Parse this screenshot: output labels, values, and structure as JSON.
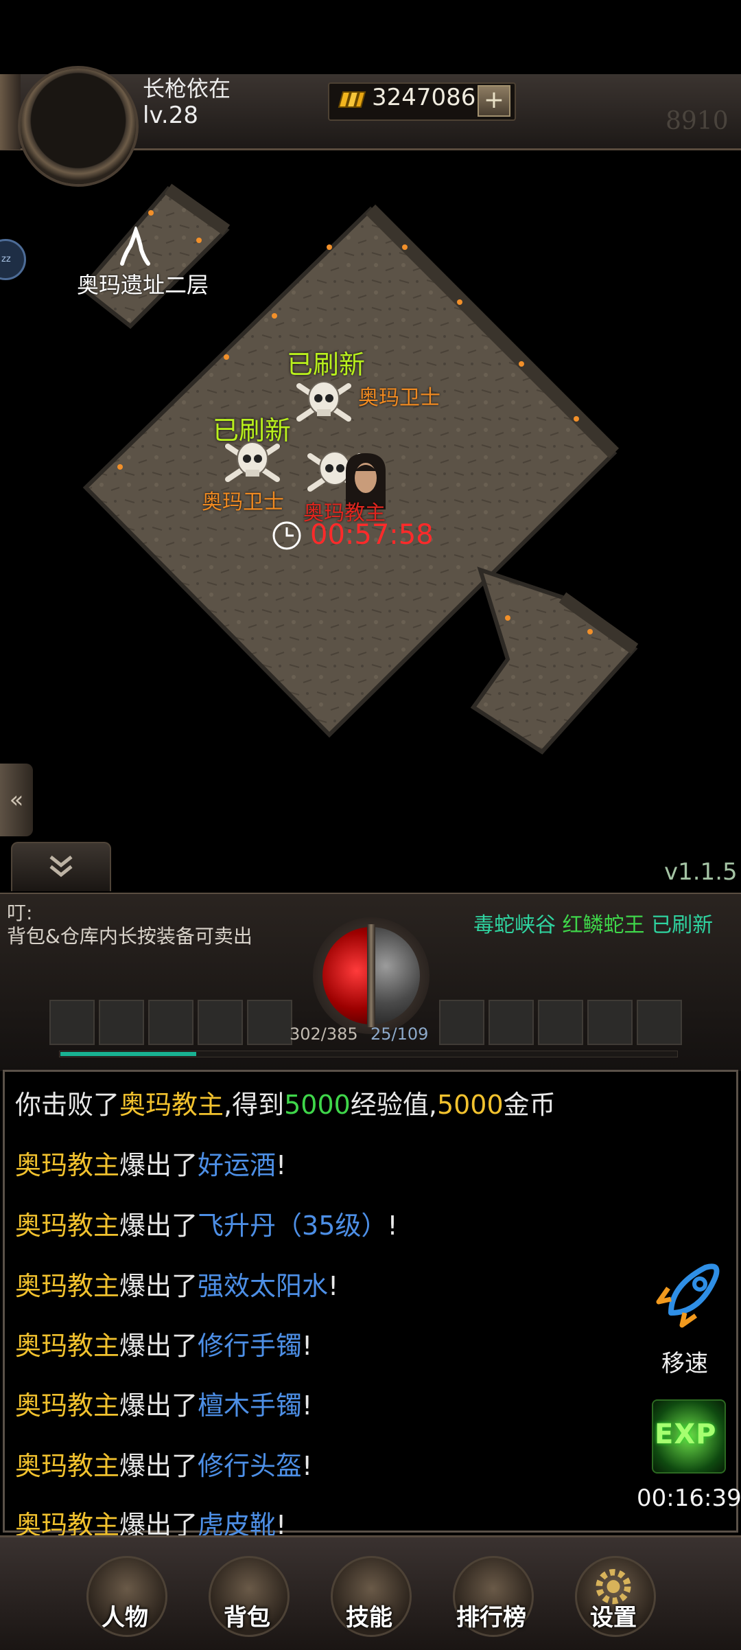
{
  "player": {
    "name": "长枪依在",
    "level": "lv.28",
    "power": "8910"
  },
  "currency": {
    "gold": "3247086",
    "add_symbol": "+"
  },
  "map": {
    "portal_label": "奥玛遗址二层",
    "refresh_label_1": "已刷新",
    "refresh_label_2": "已刷新",
    "guard_label_1": "奥玛卫士",
    "guard_label_2": "奥玛卫士",
    "boss_label": "奥玛教主",
    "boss_timer": "00:57:58",
    "side_orb_label": "zz"
  },
  "version": "v1.1.5",
  "notice": {
    "title": "叮:",
    "text": "背包&仓库内长按装备可卖出"
  },
  "boss_refresh": {
    "location": "毒蛇峡谷",
    "boss": "红鳞蛇王",
    "status": "已刷新"
  },
  "stats": {
    "hp": "302/385",
    "mp": "25/109",
    "hp_fraction": 0.784,
    "mp_fraction": 0.229,
    "xp_fraction": 0.22
  },
  "chat_log": [
    {
      "p1": "你击败了",
      "p2": "奥玛教主",
      "p3": ",得到",
      "p4": "5000",
      "p5": "经验值,",
      "p6": "5000",
      "p7": "金币"
    },
    {
      "boss": "奥玛教主",
      "mid": "爆出了",
      "item": "好运酒",
      "end": "!"
    },
    {
      "boss": "奥玛教主",
      "mid": "爆出了",
      "item": "飞升丹（35级）",
      "end": "!"
    },
    {
      "boss": "奥玛教主",
      "mid": "爆出了",
      "item": "强效太阳水",
      "end": "!"
    },
    {
      "boss": "奥玛教主",
      "mid": "爆出了",
      "item": "修行手镯",
      "end": "!"
    },
    {
      "boss": "奥玛教主",
      "mid": "爆出了",
      "item": "檀木手镯",
      "end": "!"
    },
    {
      "boss": "奥玛教主",
      "mid": "爆出了",
      "item": "修行头盔",
      "end": "!"
    },
    {
      "boss": "奥玛教主",
      "mid": "爆出了",
      "item": "虎皮靴",
      "end": "!"
    }
  ],
  "side_buttons": {
    "move_speed": "移速",
    "exp": "EXP",
    "exp_timer": "00:16:39"
  },
  "nav": [
    "人物",
    "背包",
    "技能",
    "排行榜",
    "设置"
  ],
  "colors": {
    "highlight_yellow": "#f2c22e",
    "highlight_green": "#3fd64a",
    "item_blue": "#4d8fe6",
    "refresh_green": "#b9f01d",
    "timer_red": "#ff2a2a"
  }
}
